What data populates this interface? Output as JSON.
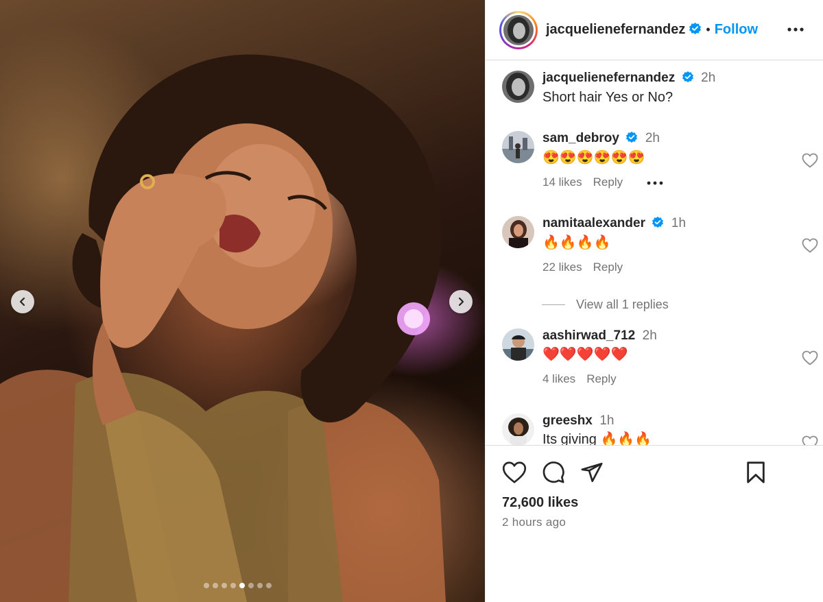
{
  "post": {
    "username": "jacquelienefernandez",
    "separator": "•",
    "follow_label": "Follow",
    "likes_count": "72,600 likes",
    "posted_ago": "2 hours ago",
    "carousel": {
      "total": 8,
      "active_index": 4
    }
  },
  "caption": {
    "username": "jacquelienefernandez",
    "time": "2h",
    "text": "Short hair Yes or No?"
  },
  "comments": [
    {
      "username": "sam_debroy",
      "verified": true,
      "time": "2h",
      "text": "😍😍😍😍😍😍",
      "likes": "14 likes",
      "reply_label": "Reply"
    },
    {
      "username": "namitaalexander",
      "verified": true,
      "time": "1h",
      "text": "🔥🔥🔥🔥",
      "likes": "22 likes",
      "reply_label": "Reply",
      "view_replies": "View all 1 replies"
    },
    {
      "username": "aashirwad_712",
      "verified": false,
      "time": "2h",
      "text": "❤️❤️❤️❤️❤️",
      "likes": "4 likes",
      "reply_label": "Reply"
    },
    {
      "username": "greeshx",
      "verified": false,
      "time": "1h",
      "text": "Its giving 🔥🔥🔥"
    }
  ],
  "colors": {
    "accent_blue": "#0095f6",
    "text_primary": "#262626",
    "text_secondary": "#737373",
    "divider": "#dbdbdb"
  },
  "icons": {
    "prev": "chevron-left-icon",
    "next": "chevron-right-icon",
    "more": "more-horizontal-icon",
    "verified": "verified-badge-icon",
    "like": "heart-icon",
    "comment": "comment-icon",
    "share": "send-icon",
    "save": "bookmark-icon"
  }
}
